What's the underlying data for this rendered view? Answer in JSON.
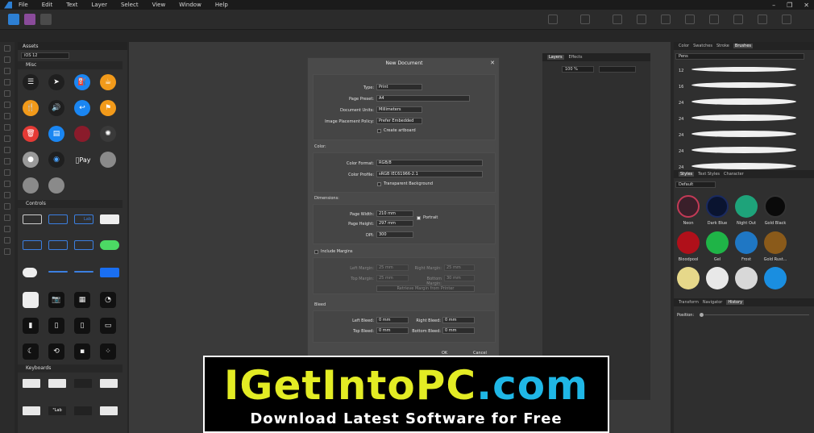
{
  "menu": [
    "File",
    "Edit",
    "Text",
    "Layer",
    "Select",
    "View",
    "Window",
    "Help"
  ],
  "assets": {
    "tab": "Assets",
    "category": "iOS 12",
    "sections": {
      "misc": "Misc",
      "controls": "Controls",
      "keyboards": "Keyboards"
    },
    "misc_text": "Pay",
    "ctrl_label": "Lab",
    "kb_label": "\"Lab"
  },
  "layers": {
    "tabs": [
      "Layers",
      "Effects"
    ],
    "opacity": "100 %"
  },
  "dialog": {
    "title": "New Document",
    "type_label": "Type:",
    "type_value": "Print",
    "preset_label": "Page Preset:",
    "preset_value": "A4",
    "units_label": "Document Units:",
    "units_value": "Millimeters",
    "placement_label": "Image Placement Policy:",
    "placement_value": "Prefer Embedded",
    "artboard_label": "Create artboard",
    "color_section": "Color:",
    "format_label": "Color Format:",
    "format_value": "RGB/8",
    "profile_label": "Color Profile:",
    "profile_value": "sRGB IEC61966-2.1",
    "transparent_label": "Transparent Background",
    "dimensions_section": "Dimensions:",
    "width_label": "Page Width:",
    "width_value": "210 mm",
    "height_label": "Page Height:",
    "height_value": "297 mm",
    "portrait_label": "Portrait",
    "dpi_label": "DPI:",
    "dpi_value": "300",
    "margins_label": "Include Margins",
    "left_margin_label": "Left Margin:",
    "left_margin_value": "25 mm",
    "right_margin_label": "Right Margin:",
    "right_margin_value": "25 mm",
    "top_margin_label": "Top Margin:",
    "top_margin_value": "25 mm",
    "bottom_margin_label": "Bottom Margin:",
    "bottom_margin_value": "30 mm",
    "retrieve_label": "Retrieve Margin from Printer",
    "bleed_section": "Bleed",
    "left_bleed_label": "Left Bleed:",
    "left_bleed_value": "0 mm",
    "right_bleed_label": "Right Bleed:",
    "right_bleed_value": "0 mm",
    "top_bleed_label": "Top Bleed:",
    "top_bleed_value": "0 mm",
    "bottom_bleed_label": "Bottom Bleed:",
    "bottom_bleed_value": "0 mm",
    "ok": "OK",
    "cancel": "Cancel"
  },
  "right": {
    "tabs1": [
      "Color",
      "Swatches",
      "Stroke",
      "Brushes"
    ],
    "brush_category": "Pens",
    "brush_sizes": [
      "12",
      "16",
      "24",
      "24",
      "24",
      "24",
      "24"
    ],
    "tabs2": [
      "Styles",
      "Text Styles",
      "Character"
    ],
    "style_category": "Default",
    "styles": [
      "Neon",
      "Dark Blue",
      "Night Out",
      "Gold Black",
      "Bloodpool",
      "Gel",
      "Frost",
      "Gold Rust..."
    ],
    "tabs3": [
      "Transform",
      "Navigator",
      "History"
    ],
    "position_label": "Position:"
  },
  "banner": {
    "brand_a": "IGetInto",
    "brand_b": "PC",
    "brand_c": ".com",
    "tagline": "Download Latest Software for Free"
  },
  "colors": {
    "accent": "#2d7fd3",
    "brand_yellow": "#e3ec24",
    "brand_cyan": "#1fb7e6"
  }
}
